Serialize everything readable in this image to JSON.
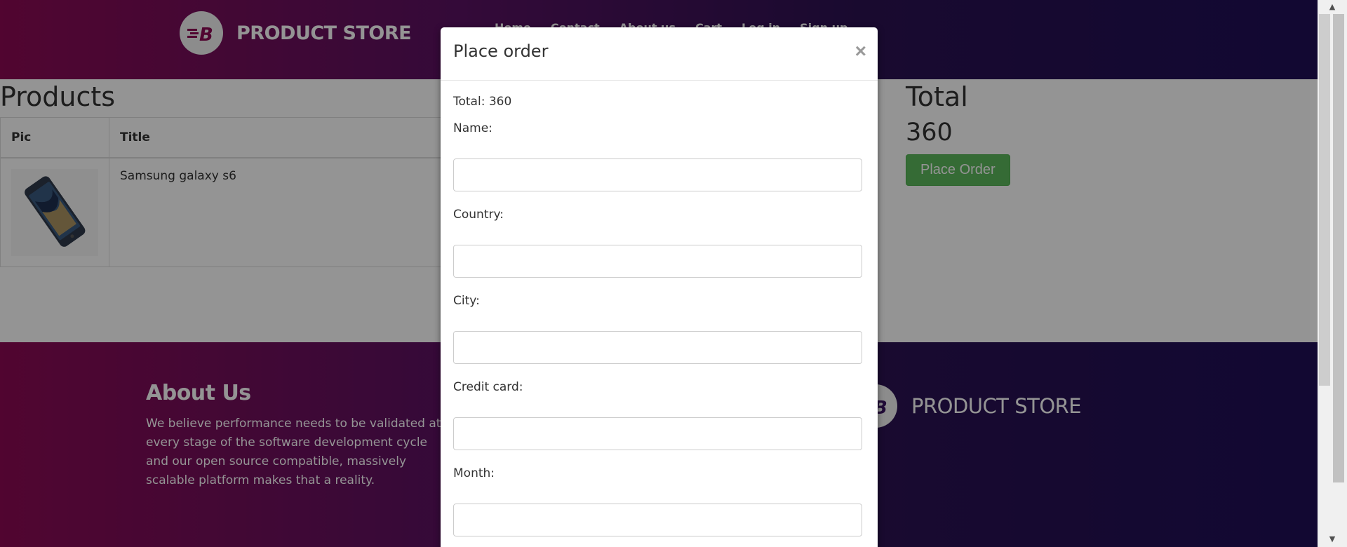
{
  "navbar": {
    "brand": "PRODUCT STORE",
    "links": [
      "Home",
      "Contact",
      "About us",
      "Cart",
      "Log in",
      "Sign up"
    ]
  },
  "products": {
    "title": "Products",
    "columns": [
      "Pic",
      "Title"
    ],
    "rows": [
      {
        "title": "Samsung galaxy s6"
      }
    ]
  },
  "total": {
    "title": "Total",
    "value": "360",
    "button": "Place Order"
  },
  "footer": {
    "about_title": "About Us",
    "about_text": "We believe performance needs to be validated at every stage of the software development cycle and our open source compatible, massively scalable platform makes that a reality.",
    "brand": "PRODUCT STORE"
  },
  "modal": {
    "title": "Place order",
    "close": "×",
    "total_text": "Total: 360",
    "fields": [
      {
        "label": "Name:",
        "value": ""
      },
      {
        "label": "Country:",
        "value": ""
      },
      {
        "label": "City:",
        "value": ""
      },
      {
        "label": "Credit card:",
        "value": ""
      },
      {
        "label": "Month:",
        "value": ""
      }
    ]
  },
  "colors": {
    "navbar_start": "#8c0a54",
    "navbar_end": "#1f0f57",
    "success_button": "#5cb85c"
  },
  "icons": {
    "logo": "blazemeter-b-logo-icon",
    "scroll_up": "arrow-up-icon",
    "scroll_down": "arrow-down-icon"
  }
}
